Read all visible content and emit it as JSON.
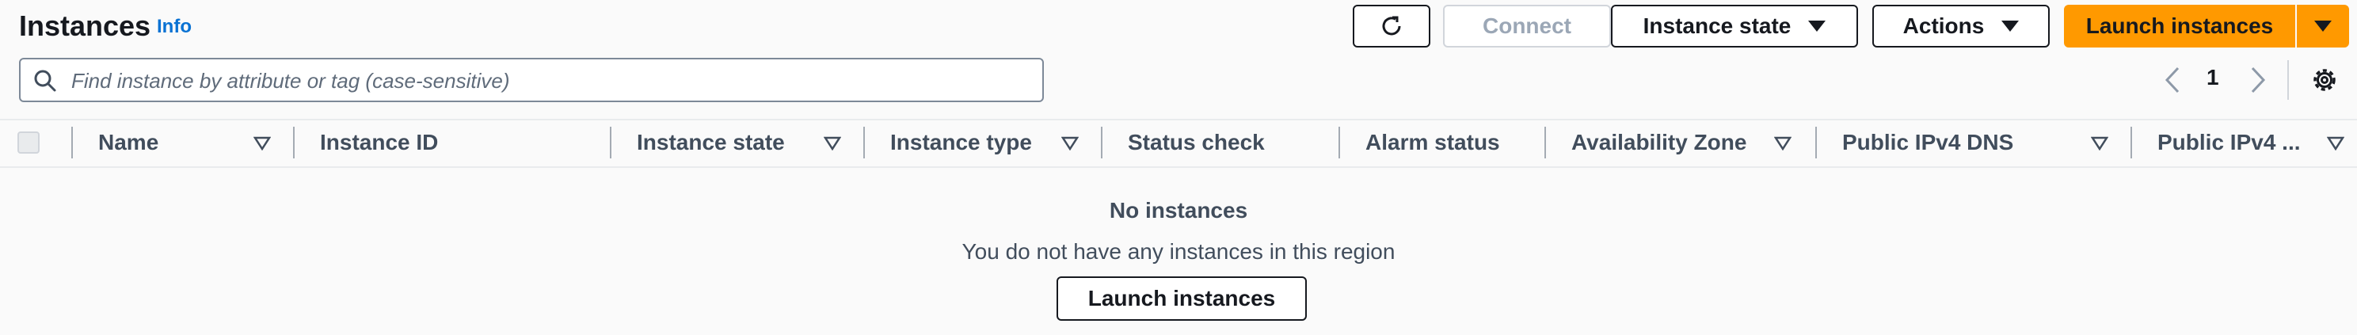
{
  "header": {
    "title": "Instances",
    "info_link": "Info"
  },
  "toolbar": {
    "refresh_icon": "refresh-icon",
    "connect_label": "Connect",
    "instance_state_label": "Instance state",
    "actions_label": "Actions",
    "launch_label": "Launch instances"
  },
  "search": {
    "placeholder": "Find instance by attribute or tag (case-sensitive)",
    "value": ""
  },
  "pagination": {
    "current_page": "1"
  },
  "table": {
    "columns": [
      "Name",
      "Instance ID",
      "Instance state",
      "Instance type",
      "Status check",
      "Alarm status",
      "Availability Zone",
      "Public IPv4 DNS",
      "Public IPv4 ..."
    ],
    "rows": []
  },
  "empty_state": {
    "title": "No instances",
    "description": "You do not have any instances in this region",
    "button_label": "Launch instances"
  },
  "colors": {
    "primary": "#ff9900",
    "link": "#0972d3",
    "text": "#16191f",
    "muted_text": "#414d5c",
    "background": "#fafafa"
  }
}
